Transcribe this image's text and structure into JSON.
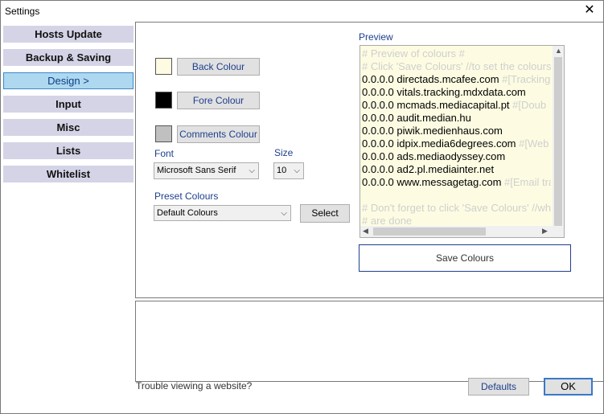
{
  "window": {
    "title": "Settings",
    "close_glyph": "✕"
  },
  "nav": {
    "items": [
      {
        "label": "Hosts Update"
      },
      {
        "label": "Backup & Saving"
      },
      {
        "label": "Design  >"
      },
      {
        "label": "Input"
      },
      {
        "label": "Misc"
      },
      {
        "label": "Lists"
      },
      {
        "label": "Whitelist"
      }
    ],
    "active_index": 2
  },
  "colours": {
    "back_label": "Back Colour",
    "fore_label": "Fore Colour",
    "comments_label": "Comments Colour",
    "back_color": "#fdfce2",
    "fore_color": "#000000",
    "comments_color": "#c0c0c0"
  },
  "font": {
    "label": "Font",
    "value": "Microsoft Sans Serif"
  },
  "size": {
    "label": "Size",
    "value": "10"
  },
  "preset": {
    "label": "Preset Colours",
    "value": "Default Colours",
    "select_label": "Select"
  },
  "preview": {
    "label": "Preview",
    "lines": [
      {
        "main": "# Preview of colours #",
        "comment": "",
        "is_comment": true
      },
      {
        "main": "# Click 'Save Colours' //to set the colours",
        "comment": "",
        "is_comment": true
      },
      {
        "main": "0.0.0.0 directads.mcafee.com ",
        "comment": "#[Tracking",
        "is_comment": false
      },
      {
        "main": "0.0.0.0 vitals.tracking.mdxdata.com",
        "comment": "",
        "is_comment": false
      },
      {
        "main": "0.0.0.0 mcmads.mediacapital.pt ",
        "comment": "#[Doub",
        "is_comment": false
      },
      {
        "main": "0.0.0.0 audit.median.hu",
        "comment": "",
        "is_comment": false
      },
      {
        "main": "0.0.0.0 piwik.medienhaus.com",
        "comment": "",
        "is_comment": false
      },
      {
        "main": "0.0.0.0 idpix.media6degrees.com ",
        "comment": "#[Web",
        "is_comment": false
      },
      {
        "main": "0.0.0.0 ads.mediaodyssey.com",
        "comment": "",
        "is_comment": false
      },
      {
        "main": "0.0.0.0 ad2.pl.mediainter.net",
        "comment": "",
        "is_comment": false
      },
      {
        "main": "0.0.0.0 www.messagetag.com ",
        "comment": "#[Email tra",
        "is_comment": false
      },
      {
        "main": "",
        "comment": "",
        "is_comment": true
      },
      {
        "main": "# Don't forget to click 'Save Colours' //wh",
        "comment": "",
        "is_comment": true
      },
      {
        "main": "# are done",
        "comment": "",
        "is_comment": true
      }
    ]
  },
  "save_colours_label": "Save Colours",
  "footer": {
    "help_text": "Trouble viewing a website?",
    "defaults_label": "Defaults",
    "ok_label": "OK"
  }
}
